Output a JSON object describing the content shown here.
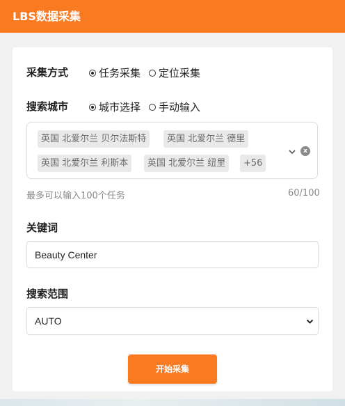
{
  "app": {
    "title": "LBS数据采集",
    "brand_color": "#fa7a22"
  },
  "collect_method": {
    "label": "采集方式",
    "options": [
      {
        "label": "任务采集",
        "checked": true
      },
      {
        "label": "定位采集",
        "checked": false
      }
    ]
  },
  "search_city": {
    "label": "搜索城市",
    "options": [
      {
        "label": "城市选择",
        "checked": true
      },
      {
        "label": "手动输入",
        "checked": false
      }
    ],
    "tags": [
      "英国 北爱尔兰 贝尔法斯特",
      "英国 北爱尔兰 德里",
      "英国 北爱尔兰 利斯本",
      "英国 北爱尔兰 纽里"
    ],
    "more_count": "+56",
    "expand_icon": "chevron-down-icon",
    "clear_icon": "clear-icon",
    "clear_glyph": "x",
    "hint": "最多可以输入100个任务",
    "counter": "60/100"
  },
  "keyword": {
    "label": "关键词",
    "value": "Beauty Center"
  },
  "search_range": {
    "label": "搜索范围",
    "selected": "AUTO"
  },
  "start_button": {
    "label": "开始采集"
  }
}
